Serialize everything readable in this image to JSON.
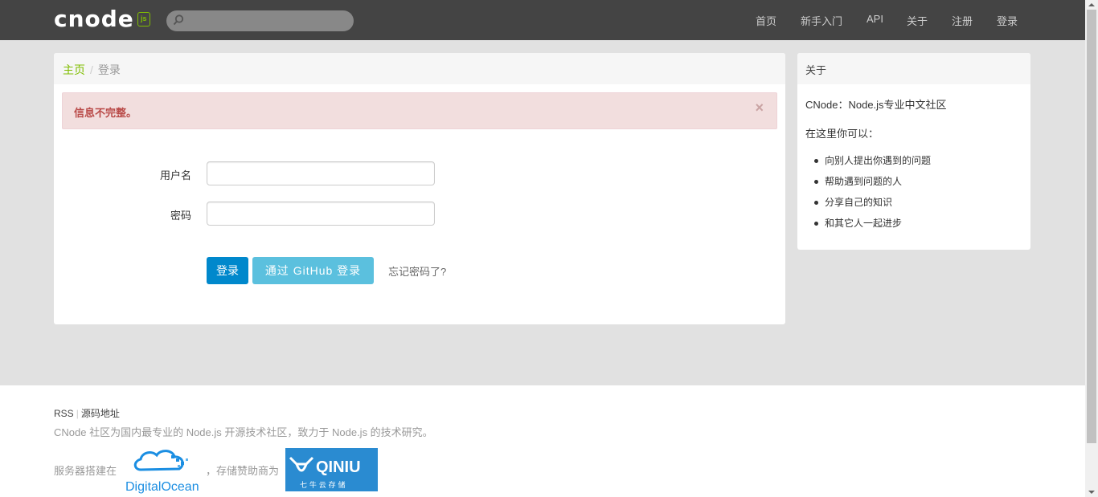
{
  "navbar": {
    "logo_text": "cnode",
    "logo_badge": "js",
    "search_placeholder": "",
    "links": [
      "首页",
      "新手入门",
      "API",
      "关于",
      "注册",
      "登录"
    ]
  },
  "breadcrumb": {
    "home": "主页",
    "separator": "/",
    "current": "登录"
  },
  "alert": {
    "message": "信息不完整。",
    "close": "×"
  },
  "form": {
    "username_label": "用户名",
    "username_value": "",
    "password_label": "密码",
    "password_value": "",
    "login_button": "登录",
    "github_button": "通过 GitHub 登录",
    "forgot_link": "忘记密码了?"
  },
  "sidebar": {
    "title": "关于",
    "intro": "CNode：Node.js专业中文社区",
    "lead": "在这里你可以：",
    "items": [
      "向别人提出你遇到的问题",
      "帮助遇到问题的人",
      "分享自己的知识",
      "和其它人一起进步"
    ]
  },
  "footer": {
    "rss": "RSS",
    "divider": "|",
    "source": "源码地址",
    "description": "CNode 社区为国内最专业的 Node.js 开源技术社区，致力于 Node.js 的技术研究。",
    "hosted_on": "服务器搭建在",
    "storage_sponsor": "，存储赞助商为",
    "do_logo_text": "DigitalOcean",
    "qiniu_logo_text": "QINIU",
    "qiniu_logo_subtext": "七 牛 云 存 储"
  },
  "colors": {
    "navbar_bg": "#444444",
    "accent_green": "#80bd01",
    "primary_blue": "#0088cc",
    "info_blue": "#5bc0de",
    "alert_bg": "#f2dede",
    "alert_text": "#b94a48"
  }
}
